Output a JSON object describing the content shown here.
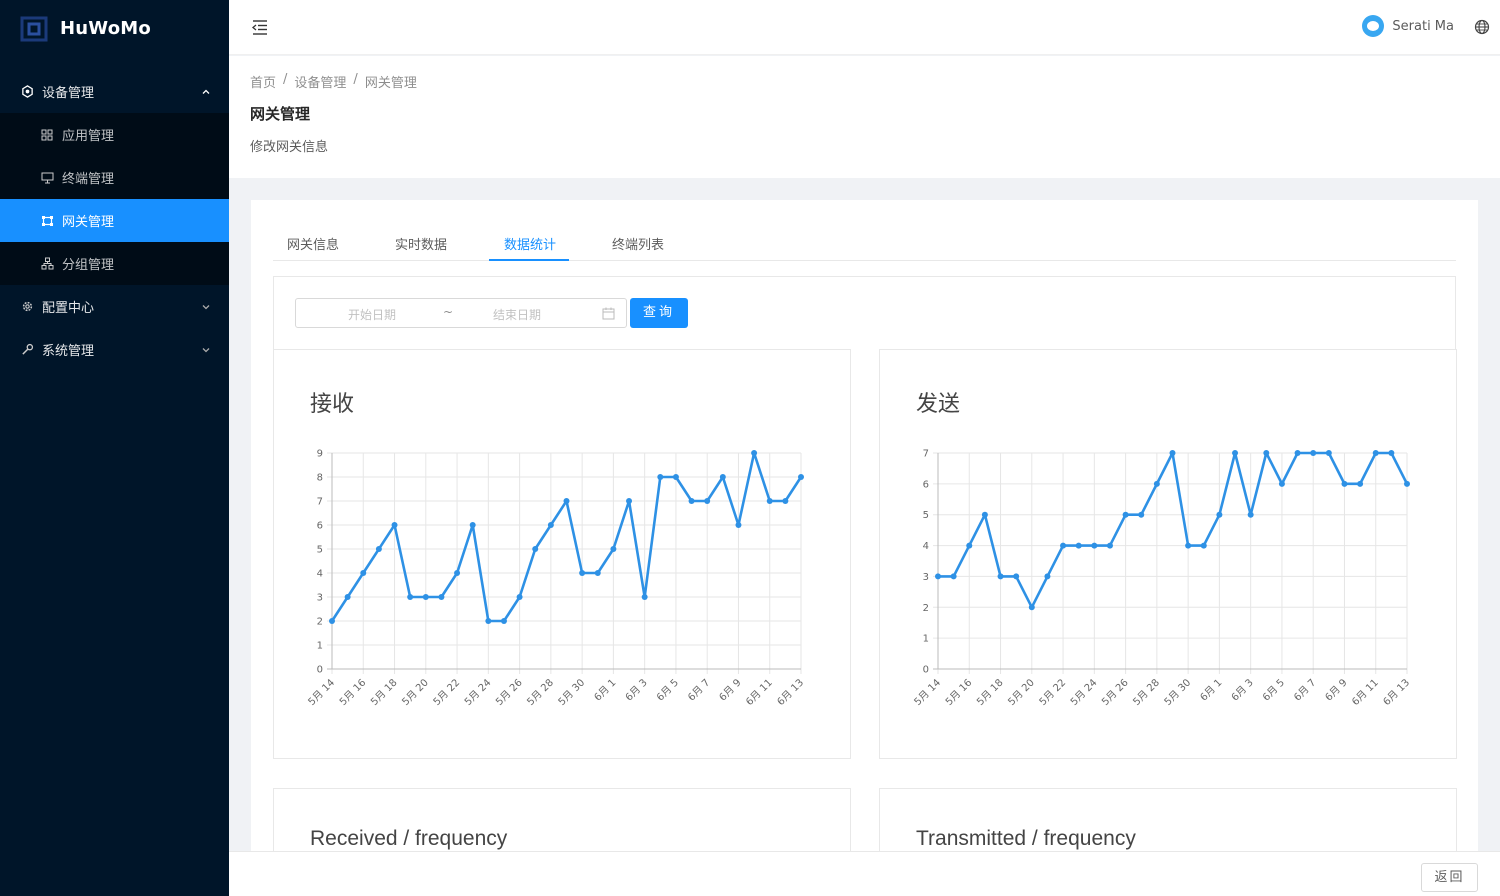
{
  "app": {
    "name": "HuWoMo"
  },
  "sidebar": {
    "groups": [
      {
        "label": "设备管理",
        "icon": "device-icon",
        "expanded": true,
        "items": [
          {
            "label": "应用管理",
            "icon": "app-grid-icon",
            "active": false
          },
          {
            "label": "终端管理",
            "icon": "monitor-icon",
            "active": false
          },
          {
            "label": "网关管理",
            "icon": "gateway-icon",
            "active": true
          },
          {
            "label": "分组管理",
            "icon": "cluster-icon",
            "active": false
          }
        ]
      },
      {
        "label": "配置中心",
        "icon": "gear-icon",
        "expanded": false
      },
      {
        "label": "系统管理",
        "icon": "wrench-icon",
        "expanded": false
      }
    ]
  },
  "header": {
    "username": "Serati Ma"
  },
  "breadcrumb": [
    "首页",
    "设备管理",
    "网关管理"
  ],
  "page": {
    "title": "网关管理",
    "description": "修改网关信息"
  },
  "tabs": [
    "网关信息",
    "实时数据",
    "数据统计",
    "终端列表"
  ],
  "active_tab": "数据统计",
  "filter": {
    "start_placeholder": "开始日期",
    "separator": "~",
    "end_placeholder": "结束日期",
    "query_label": "查询"
  },
  "colors": {
    "primary": "#1890ff",
    "sidebar_bg": "#001529",
    "line": "#2e91e5"
  },
  "chart_data": [
    {
      "type": "line",
      "title": "接收",
      "x": [
        "5月 14",
        "5月 15",
        "5月 16",
        "5月 17",
        "5月 18",
        "5月 19",
        "5月 20",
        "5月 21",
        "5月 22",
        "5月 23",
        "5月 24",
        "5月 25",
        "5月 26",
        "5月 27",
        "5月 28",
        "5月 29",
        "5月 30",
        "5月 31",
        "6月 1",
        "6月 2",
        "6月 3",
        "6月 4",
        "6月 5",
        "6月 6",
        "6月 7",
        "6月 8",
        "6月 9",
        "6月 10",
        "6月 11",
        "6月 12",
        "6月 13"
      ],
      "x_ticks": [
        "5月 14",
        "5月 16",
        "5月 18",
        "5月 20",
        "5月 22",
        "5月 24",
        "5月 26",
        "5月 28",
        "5月 30",
        "6月 1",
        "6月 3",
        "6月 5",
        "6月 7",
        "6月 9",
        "6月 11",
        "6月 13"
      ],
      "values": [
        2,
        3,
        4,
        5,
        6,
        3,
        3,
        3,
        4,
        6,
        2,
        2,
        3,
        5,
        6,
        7,
        4,
        4,
        5,
        7,
        3,
        8,
        8,
        7,
        7,
        8,
        6,
        9,
        7,
        7,
        8
      ],
      "ylim": [
        0,
        9
      ],
      "yticks": [
        0,
        1,
        2,
        3,
        4,
        5,
        6,
        7,
        8,
        9
      ],
      "grid": true
    },
    {
      "type": "line",
      "title": "发送",
      "x": [
        "5月 14",
        "5月 15",
        "5月 16",
        "5月 17",
        "5月 18",
        "5月 19",
        "5月 20",
        "5月 21",
        "5月 22",
        "5月 23",
        "5月 24",
        "5月 25",
        "5月 26",
        "5月 27",
        "5月 28",
        "5月 29",
        "5月 30",
        "5月 31",
        "6月 1",
        "6月 2",
        "6月 3",
        "6月 4",
        "6月 5",
        "6月 6",
        "6月 7",
        "6月 8",
        "6月 9",
        "6月 10",
        "6月 11",
        "6月 12",
        "6月 13"
      ],
      "x_ticks": [
        "5月 14",
        "5月 16",
        "5月 18",
        "5月 20",
        "5月 22",
        "5月 24",
        "5月 26",
        "5月 28",
        "5月 30",
        "6月 1",
        "6月 3",
        "6月 5",
        "6月 7",
        "6月 9",
        "6月 11",
        "6月 13"
      ],
      "values": [
        3,
        3,
        4,
        5,
        3,
        3,
        2,
        3,
        4,
        4,
        4,
        4,
        5,
        5,
        6,
        7,
        4,
        4,
        5,
        7,
        5,
        7,
        6,
        7,
        7,
        7,
        6,
        6,
        7,
        7,
        6
      ],
      "ylim": [
        0,
        7
      ],
      "yticks": [
        0,
        1,
        2,
        3,
        4,
        5,
        6,
        7
      ],
      "grid": true
    }
  ],
  "frequency_cards": [
    "Received / frequency",
    "Transmitted / frequency"
  ],
  "footer": {
    "back_label": "返回"
  }
}
